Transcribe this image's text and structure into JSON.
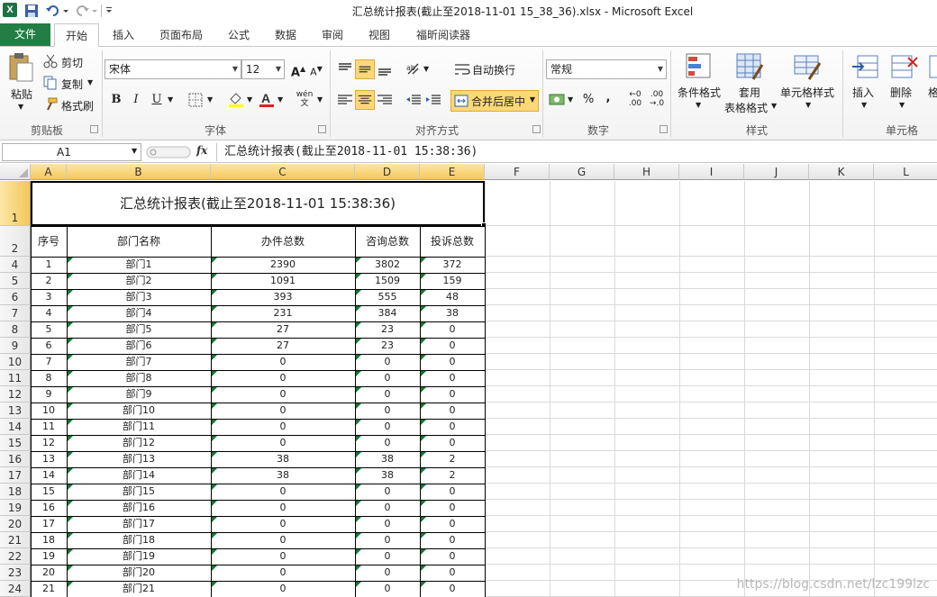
{
  "window": {
    "title": "汇总统计报表(截止至2018-11-01 15_38_36).xlsx  -  Microsoft Excel",
    "logo": "X"
  },
  "tabs": [
    "文件",
    "开始",
    "插入",
    "页面布局",
    "公式",
    "数据",
    "审阅",
    "视图",
    "福昕阅读器"
  ],
  "ribbon": {
    "clipboard": {
      "paste": "粘贴",
      "cut": "剪切",
      "copy": "复制",
      "format_painter": "格式刷",
      "label": "剪贴板"
    },
    "font": {
      "name": "宋体",
      "size": "12",
      "bold": "B",
      "italic": "I",
      "underline": "U",
      "label": "字体"
    },
    "alignment": {
      "wrap": "自动换行",
      "merge": "合并后居中",
      "label": "对齐方式"
    },
    "number": {
      "format": "常规",
      "percent": "%",
      "comma": ",",
      "label": "数字"
    },
    "styles": {
      "conditional": "条件格式",
      "table_fmt_1": "套用",
      "table_fmt_2": "表格格式",
      "cell_styles": "单元格样式",
      "label": "样式"
    },
    "cells": {
      "insert": "插入",
      "delete": "删除",
      "format": "格",
      "label": "单元格"
    }
  },
  "formula_bar": {
    "name_box": "A1",
    "fx": "fx",
    "content": "汇总统计报表(截止至2018-11-01 15:38:36)"
  },
  "columns": [
    "A",
    "B",
    "C",
    "D",
    "E",
    "F",
    "G",
    "H",
    "I",
    "J",
    "K",
    "L"
  ],
  "sheet": {
    "title": "汇总统计报表(截止至2018-11-01 15:38:36)",
    "headers": [
      "序号",
      "部门名称",
      "办件总数",
      "咨询总数",
      "投诉总数"
    ],
    "header_row_number": "2",
    "title_row_number": "1",
    "rows": [
      {
        "row": "4",
        "cells": [
          "1",
          "部门1",
          "2390",
          "3802",
          "372"
        ]
      },
      {
        "row": "5",
        "cells": [
          "2",
          "部门2",
          "1091",
          "1509",
          "159"
        ]
      },
      {
        "row": "6",
        "cells": [
          "3",
          "部门3",
          "393",
          "555",
          "48"
        ]
      },
      {
        "row": "7",
        "cells": [
          "4",
          "部门4",
          "231",
          "384",
          "38"
        ]
      },
      {
        "row": "8",
        "cells": [
          "5",
          "部门5",
          "27",
          "23",
          "0"
        ]
      },
      {
        "row": "9",
        "cells": [
          "6",
          "部门6",
          "27",
          "23",
          "0"
        ]
      },
      {
        "row": "10",
        "cells": [
          "7",
          "部门7",
          "0",
          "0",
          "0"
        ]
      },
      {
        "row": "11",
        "cells": [
          "8",
          "部门8",
          "0",
          "0",
          "0"
        ]
      },
      {
        "row": "12",
        "cells": [
          "9",
          "部门9",
          "0",
          "0",
          "0"
        ]
      },
      {
        "row": "13",
        "cells": [
          "10",
          "部门10",
          "0",
          "0",
          "0"
        ]
      },
      {
        "row": "14",
        "cells": [
          "11",
          "部门11",
          "0",
          "0",
          "0"
        ]
      },
      {
        "row": "15",
        "cells": [
          "12",
          "部门12",
          "0",
          "0",
          "0"
        ]
      },
      {
        "row": "16",
        "cells": [
          "13",
          "部门13",
          "38",
          "38",
          "2"
        ]
      },
      {
        "row": "17",
        "cells": [
          "14",
          "部门14",
          "38",
          "38",
          "2"
        ]
      },
      {
        "row": "18",
        "cells": [
          "15",
          "部门15",
          "0",
          "0",
          "0"
        ]
      },
      {
        "row": "19",
        "cells": [
          "16",
          "部门16",
          "0",
          "0",
          "0"
        ]
      },
      {
        "row": "20",
        "cells": [
          "17",
          "部门17",
          "0",
          "0",
          "0"
        ]
      },
      {
        "row": "21",
        "cells": [
          "18",
          "部门18",
          "0",
          "0",
          "0"
        ]
      },
      {
        "row": "22",
        "cells": [
          "19",
          "部门19",
          "0",
          "0",
          "0"
        ]
      },
      {
        "row": "23",
        "cells": [
          "20",
          "部门20",
          "0",
          "0",
          "0"
        ]
      },
      {
        "row": "24",
        "cells": [
          "21",
          "部门21",
          "0",
          "0",
          "0"
        ]
      }
    ]
  },
  "watermark": "https://blog.csdn.net/lzc199lzc",
  "colors": {
    "file_tab": "#227e45",
    "selection_header": "#f5c75a",
    "indicator": "#0b7a31"
  }
}
